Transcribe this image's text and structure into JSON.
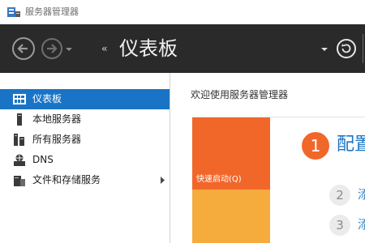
{
  "window": {
    "title": "服务器管理器",
    "icon": "server-manager-icon"
  },
  "navbar": {
    "breadcrumb_arrows": "‹‹",
    "title": "仪表板",
    "back_icon": "back-arrow-icon",
    "forward_icon": "forward-arrow-icon",
    "refresh_icon": "refresh-icon"
  },
  "sidebar": {
    "items": [
      {
        "label": "仪表板",
        "icon": "dashboard-icon",
        "active": true
      },
      {
        "label": "本地服务器",
        "icon": "local-server-icon",
        "active": false
      },
      {
        "label": "所有服务器",
        "icon": "all-servers-icon",
        "active": false
      },
      {
        "label": "DNS",
        "icon": "dns-icon",
        "active": false
      },
      {
        "label": "文件和存储服务",
        "icon": "file-storage-icon",
        "active": false,
        "has_submenu": true
      }
    ]
  },
  "main": {
    "welcome": "欢迎使用服务器管理器",
    "quick_start_tile": "快速启动(Q)",
    "steps": [
      {
        "number": "1",
        "label": "配置"
      },
      {
        "number": "2",
        "label": "添"
      },
      {
        "number": "3",
        "label": "添"
      }
    ]
  },
  "colors": {
    "nav_background": "#2a2a2a",
    "active_item": "#1a74c6",
    "quick_start_orange": "#f1672a",
    "tile_amber": "#f6ab3d",
    "link_blue": "#1a74c6"
  }
}
